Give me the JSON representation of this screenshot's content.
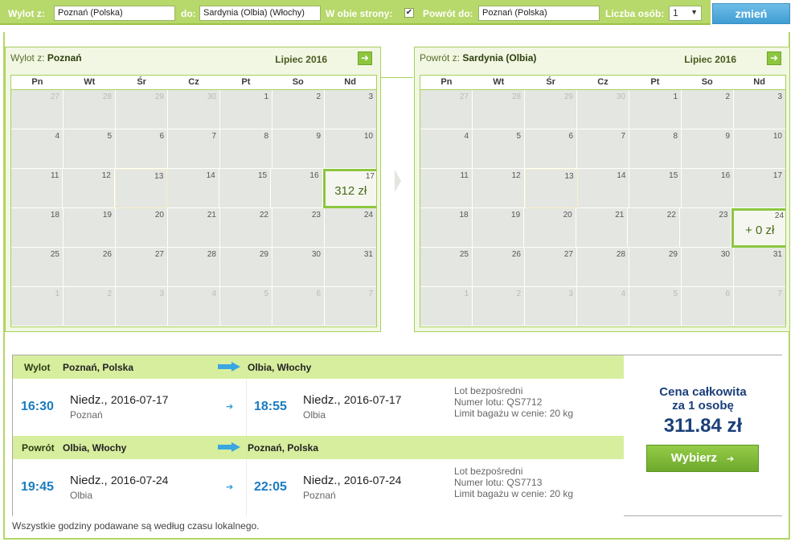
{
  "search": {
    "from_label": "Wylot z:",
    "from_value": "Poznań (Polska)",
    "to_label": "do:",
    "to_value": "Sardynia (Olbia) (Włochy)",
    "roundtrip_label": "W obie strony:",
    "roundtrip_checked": "✔",
    "return_label": "Powrót do:",
    "return_value": "Poznań (Polska)",
    "persons_label": "Liczba osób:",
    "persons_value": "1",
    "change_button": "zmień"
  },
  "colors": {
    "accent_green": "#8cc63f",
    "header_green": "#b7d86a",
    "time_blue": "#1a7cc0",
    "price_navy": "#1b3f7a"
  },
  "outbound_calendar": {
    "title_prefix": "Wylot z:",
    "title_city": "Poznań",
    "month": "Lipiec 2016",
    "selected_price": "312 zł"
  },
  "return_calendar": {
    "title_prefix": "Powrót z:",
    "title_city": "Sardynia (Olbia)",
    "month": "Lipiec 2016",
    "selected_price": "+ 0 zł"
  },
  "weekdays": [
    "Pn",
    "Wt",
    "Śr",
    "Cz",
    "Pt",
    "So",
    "Nd"
  ],
  "outbound": {
    "head_label": "Wylot",
    "from_city": "Poznań, Polska",
    "to_city": "Olbia, Włochy",
    "dep_time": "16:30",
    "dep_day": "Niedz.,",
    "dep_date": "2016-07-17",
    "dep_city": "Poznań",
    "arr_time": "18:55",
    "arr_day": "Niedz.,",
    "arr_date": "2016-07-17",
    "arr_city": "Olbia",
    "info_direct": "Lot bezpośredni",
    "info_flight": "Numer lotu: QS7712",
    "info_baggage": "Limit bagażu w cenie: 20 kg"
  },
  "inbound": {
    "head_label": "Powrót",
    "from_city": "Olbia, Włochy",
    "to_city": "Poznań, Polska",
    "dep_time": "19:45",
    "dep_day": "Niedz.,",
    "dep_date": "2016-07-24",
    "dep_city": "Olbia",
    "arr_time": "22:05",
    "arr_day": "Niedz.,",
    "arr_date": "2016-07-24",
    "arr_city": "Poznań",
    "info_direct": "Lot bezpośredni",
    "info_flight": "Numer lotu: QS7713",
    "info_baggage": "Limit bagażu w cenie: 20 kg"
  },
  "price": {
    "label_line1": "Cena całkowita",
    "label_line2": "za 1 osobę",
    "amount": "311.84 zł",
    "select_button": "Wybierz"
  },
  "footnote": "Wszystkie godziny podawane są według czasu lokalnego.",
  "calendar_weeks": [
    [
      {
        "n": "27",
        "o": true
      },
      {
        "n": "28",
        "o": true
      },
      {
        "n": "29",
        "o": true
      },
      {
        "n": "30",
        "o": true
      },
      {
        "n": "1"
      },
      {
        "n": "2"
      },
      {
        "n": "3"
      }
    ],
    [
      {
        "n": "4"
      },
      {
        "n": "5"
      },
      {
        "n": "6"
      },
      {
        "n": "7"
      },
      {
        "n": "8"
      },
      {
        "n": "9"
      },
      {
        "n": "10"
      }
    ],
    [
      {
        "n": "11"
      },
      {
        "n": "12"
      },
      {
        "n": "13",
        "today": true
      },
      {
        "n": "14"
      },
      {
        "n": "15"
      },
      {
        "n": "16"
      },
      {
        "n": "17"
      }
    ],
    [
      {
        "n": "18"
      },
      {
        "n": "19"
      },
      {
        "n": "20"
      },
      {
        "n": "21"
      },
      {
        "n": "22"
      },
      {
        "n": "23"
      },
      {
        "n": "24"
      }
    ],
    [
      {
        "n": "25"
      },
      {
        "n": "26"
      },
      {
        "n": "27"
      },
      {
        "n": "28"
      },
      {
        "n": "29"
      },
      {
        "n": "30"
      },
      {
        "n": "31"
      }
    ],
    [
      {
        "n": "1",
        "o": true
      },
      {
        "n": "2",
        "o": true
      },
      {
        "n": "3",
        "o": true
      },
      {
        "n": "4",
        "o": true
      },
      {
        "n": "5",
        "o": true
      },
      {
        "n": "6",
        "o": true
      },
      {
        "n": "7",
        "o": true
      }
    ]
  ],
  "outbound_selected_day": "17",
  "return_selected_day": "24"
}
